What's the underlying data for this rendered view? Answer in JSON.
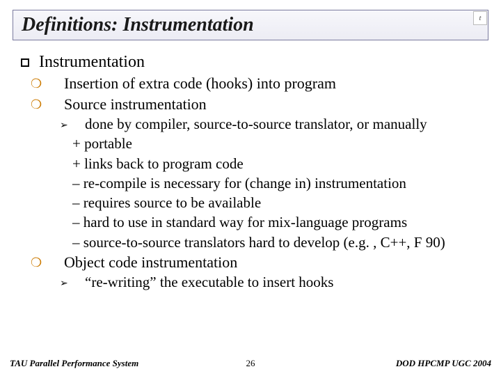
{
  "title": "Definitions: Instrumentation",
  "logo_glyph": "t",
  "content": {
    "h1": "Instrumentation",
    "p1": "Insertion of extra code (hooks) into program",
    "p2": "Source instrumentation",
    "s1": "done by compiler, source-to-source translator, or manually",
    "s2": "+ portable",
    "s3": "+ links back to program code",
    "s4": "– re-compile is necessary for (change in) instrumentation",
    "s5": "– requires source to be available",
    "s6": "– hard to use in standard way for mix-language programs",
    "s7": "– source-to-source translators hard to develop (e.g. , C++, F 90)",
    "p3": "Object code instrumentation",
    "o1": "“re-writing” the executable to insert hooks"
  },
  "footer": {
    "left": "TAU Parallel Performance System",
    "center": "26",
    "right": "DOD HPCMP UGC 2004"
  }
}
